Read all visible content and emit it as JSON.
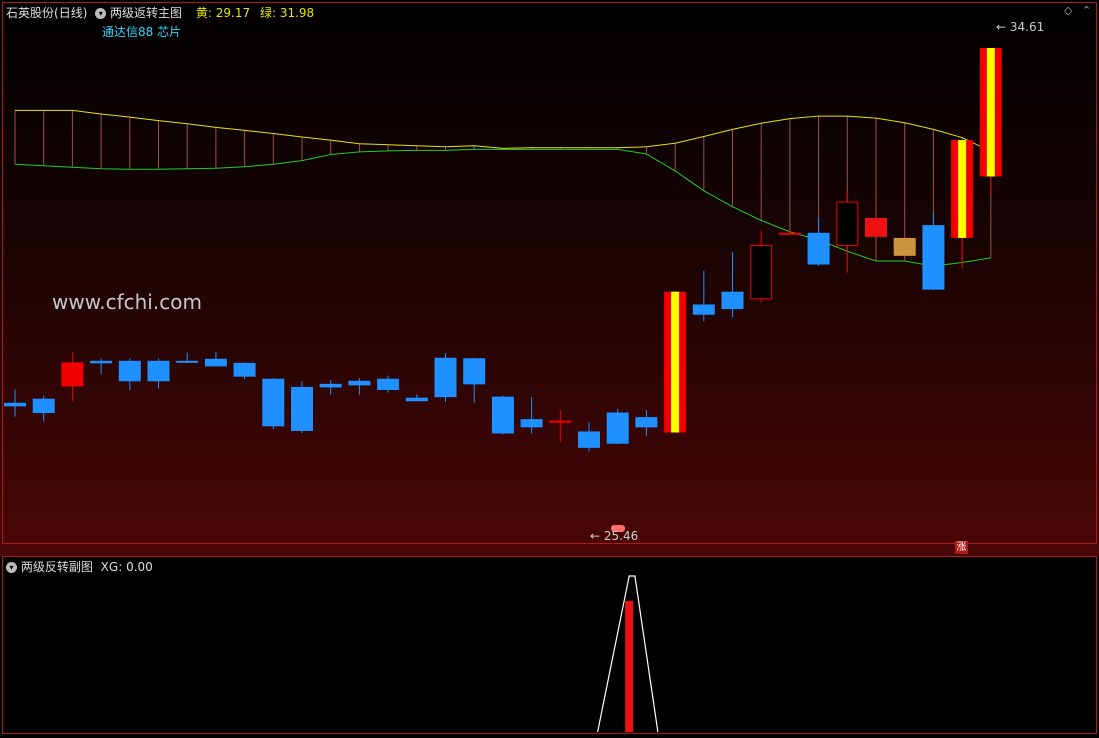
{
  "main_panel": {
    "stock_name": "石英股份",
    "period": "(日线)",
    "indicator_name": "两级返转主图",
    "yellow_label": "黄:",
    "yellow_value": "29.17",
    "green_label": "绿:",
    "green_value": "31.98",
    "source_label": "通达信88 芯片",
    "watermark": "www.cfchi.com",
    "high_label": "34.61",
    "low_label": "25.46",
    "rise_tag": "涨"
  },
  "sub_panel": {
    "indicator_name": "两级反转副图",
    "xg_label": "XG:",
    "xg_value": "0.00"
  },
  "colors": {
    "up": "#f00000",
    "down": "#1e90ff",
    "limit_yellow": "#ffff00",
    "yellow_line": "#e6e600",
    "green_line": "#22cc22",
    "frame": "#b01818"
  },
  "chart_data": [
    {
      "type": "candlestick",
      "price_axis": {
        "ylim": [
          25.0,
          35.0
        ]
      },
      "candles": [
        {
          "o": 27.68,
          "h": 27.94,
          "l": 27.41,
          "c": 27.61
        },
        {
          "o": 27.76,
          "h": 27.82,
          "l": 27.31,
          "c": 27.48
        },
        {
          "o": 28.0,
          "h": 28.66,
          "l": 27.71,
          "c": 28.47
        },
        {
          "o": 28.5,
          "h": 28.55,
          "l": 28.24,
          "c": 28.45
        },
        {
          "o": 28.5,
          "h": 28.55,
          "l": 27.93,
          "c": 28.1
        },
        {
          "o": 28.5,
          "h": 28.54,
          "l": 27.96,
          "c": 28.1
        },
        {
          "o": 28.5,
          "h": 28.66,
          "l": 28.46,
          "c": 28.48
        },
        {
          "o": 28.54,
          "h": 28.67,
          "l": 28.44,
          "c": 28.39
        },
        {
          "o": 28.46,
          "h": 28.47,
          "l": 28.14,
          "c": 28.19
        },
        {
          "o": 28.15,
          "h": 28.16,
          "l": 27.17,
          "c": 27.22
        },
        {
          "o": 27.99,
          "h": 28.1,
          "l": 27.09,
          "c": 27.13
        },
        {
          "o": 28.05,
          "h": 28.12,
          "l": 27.84,
          "c": 27.98
        },
        {
          "o": 28.11,
          "h": 28.16,
          "l": 27.84,
          "c": 28.02
        },
        {
          "o": 28.15,
          "h": 28.21,
          "l": 27.88,
          "c": 27.93
        },
        {
          "o": 27.78,
          "h": 27.84,
          "l": 27.73,
          "c": 27.71
        },
        {
          "o": 28.56,
          "h": 28.65,
          "l": 27.7,
          "c": 27.79
        },
        {
          "o": 28.55,
          "h": 28.56,
          "l": 27.68,
          "c": 28.04
        },
        {
          "o": 27.8,
          "h": 27.82,
          "l": 27.06,
          "c": 27.08
        },
        {
          "o": 27.36,
          "h": 27.79,
          "l": 27.08,
          "c": 27.2
        },
        {
          "o": 27.33,
          "h": 27.53,
          "l": 26.91,
          "c": 27.33
        },
        {
          "o": 27.12,
          "h": 27.3,
          "l": 26.73,
          "c": 26.8
        },
        {
          "o": 27.49,
          "h": 27.56,
          "l": 26.87,
          "c": 26.88
        },
        {
          "o": 27.4,
          "h": 27.54,
          "l": 27.03,
          "c": 27.2
        },
        {
          "o": 27.1,
          "h": 29.85,
          "l": 27.1,
          "c": 29.85,
          "limit": true
        },
        {
          "o": 29.6,
          "h": 30.26,
          "l": 29.27,
          "c": 29.4
        },
        {
          "o": 29.85,
          "h": 30.62,
          "l": 29.35,
          "c": 29.51
        },
        {
          "o": 29.71,
          "h": 31.04,
          "l": 29.64,
          "c": 30.75
        },
        {
          "o": 31.0,
          "h": 31.04,
          "l": 30.98,
          "c": 31.0
        },
        {
          "o": 31.0,
          "h": 31.3,
          "l": 30.35,
          "c": 30.38
        },
        {
          "o": 30.75,
          "h": 31.8,
          "l": 30.22,
          "c": 31.6
        },
        {
          "o": 31.29,
          "h": 31.29,
          "l": 30.92,
          "c": 31.05
        },
        {
          "o": 30.8,
          "h": 30.85,
          "l": 30.72,
          "c": 30.71
        },
        {
          "o": 31.15,
          "h": 31.39,
          "l": 29.88,
          "c": 29.89
        },
        {
          "o": 30.9,
          "h": 32.81,
          "l": 30.3,
          "c": 32.81,
          "limit": true
        },
        {
          "o": 32.1,
          "h": 34.61,
          "l": 31.75,
          "c": 34.61,
          "limit": true
        }
      ],
      "yellow_line": [
        33.39,
        33.39,
        33.39,
        33.32,
        33.26,
        33.19,
        33.13,
        33.06,
        33.0,
        32.94,
        32.87,
        32.81,
        32.74,
        32.72,
        32.7,
        32.68,
        32.7,
        32.65,
        32.66,
        32.66,
        32.66,
        32.66,
        32.68,
        32.75,
        32.88,
        33.02,
        33.14,
        33.23,
        33.28,
        33.28,
        33.24,
        33.15,
        33.02,
        32.86,
        32.59
      ],
      "green_line": [
        32.34,
        32.31,
        32.28,
        32.25,
        32.24,
        32.24,
        32.25,
        32.26,
        32.29,
        32.34,
        32.41,
        32.53,
        32.58,
        32.6,
        32.61,
        32.61,
        32.63,
        32.63,
        32.63,
        32.63,
        32.63,
        32.63,
        32.54,
        32.21,
        31.82,
        31.51,
        31.24,
        31.02,
        30.86,
        30.64,
        30.45,
        30.45,
        30.35,
        30.42,
        30.51
      ]
    },
    {
      "type": "area",
      "series": [
        {
          "x": [
            20.3,
            21.4,
            21.6,
            22.4
          ],
          "values": [
            0,
            1.0,
            1.0,
            0
          ]
        }
      ],
      "bar_index": 21.4,
      "bar_value": 0.84,
      "ylim": [
        0,
        1.0
      ]
    }
  ]
}
